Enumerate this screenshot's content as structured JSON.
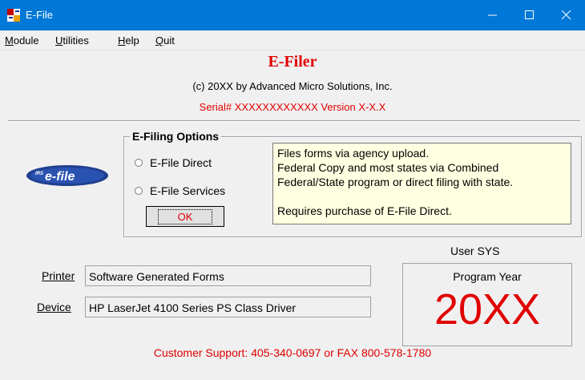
{
  "window": {
    "title": "E-File",
    "controls": {
      "minimize": "—",
      "maximize": "☐",
      "close": "✕"
    }
  },
  "menu": [
    {
      "label": "Module"
    },
    {
      "label": "Utilities"
    },
    {
      "label": "Help"
    },
    {
      "label": "Quit"
    }
  ],
  "header": {
    "app_name": "E-Filer",
    "copyright": "(c) 20XX by Advanced Micro Solutions, Inc.",
    "serial": "Serial# XXXXXXXXXXXX   Version X-X.X"
  },
  "logo": {
    "text_irs": "IRS",
    "text_main": "e-file"
  },
  "options": {
    "title": "E-Filing Options",
    "radios": [
      {
        "label": "E-File Direct",
        "selected": false
      },
      {
        "label": "E-File Services",
        "selected": false
      }
    ],
    "ok_label": "OK",
    "description_lines": [
      "Files forms via agency upload.",
      "Federal Copy and most states via Combined",
      "Federal/State program or direct filing with state.",
      "",
      "Requires purchase of E-File Direct."
    ]
  },
  "printer": {
    "label": "Printer",
    "value": "Software Generated Forms"
  },
  "device": {
    "label": "Device",
    "value": "HP LaserJet 4100 Series PS Class Driver"
  },
  "user": "User SYS",
  "program_year": {
    "label": "Program Year",
    "value": "20XX"
  },
  "support": "Customer Support: 405-340-0697  or  FAX  800-578-1780",
  "colors": {
    "accent_red": "#e00000",
    "titlebar_blue": "#0078d7",
    "info_bg": "#ffffe1"
  }
}
